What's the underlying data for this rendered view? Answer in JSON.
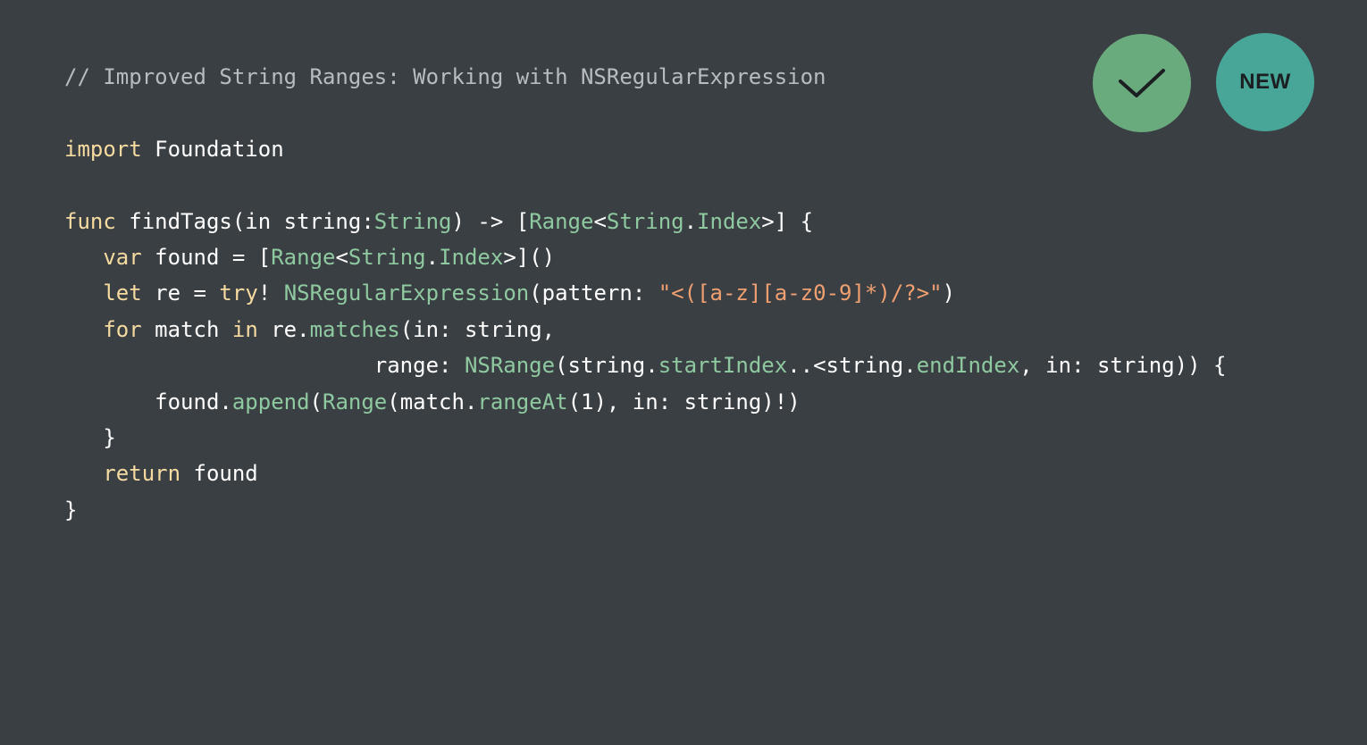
{
  "badges": {
    "check": {
      "icon": "checkmark-icon",
      "color": "#6aab7e"
    },
    "new": {
      "label": "NEW",
      "color": "#48a698"
    }
  },
  "code": {
    "lines": [
      [
        {
          "text": "// Improved String Ranges: Working with NSRegularExpression",
          "kind": "comment"
        }
      ],
      [],
      [
        {
          "text": "import",
          "kind": "keyword"
        },
        {
          "text": " Foundation",
          "kind": "plain"
        }
      ],
      [],
      [
        {
          "text": "func",
          "kind": "keyword"
        },
        {
          "text": " findTags(in string:",
          "kind": "plain"
        },
        {
          "text": "String",
          "kind": "type"
        },
        {
          "text": ") -> [",
          "kind": "plain"
        },
        {
          "text": "Range",
          "kind": "type"
        },
        {
          "text": "<",
          "kind": "plain"
        },
        {
          "text": "String",
          "kind": "type"
        },
        {
          "text": ".",
          "kind": "plain"
        },
        {
          "text": "Index",
          "kind": "type"
        },
        {
          "text": ">] {",
          "kind": "plain"
        }
      ],
      [
        {
          "text": "   ",
          "kind": "plain"
        },
        {
          "text": "var",
          "kind": "keyword"
        },
        {
          "text": " found = [",
          "kind": "plain"
        },
        {
          "text": "Range",
          "kind": "type"
        },
        {
          "text": "<",
          "kind": "plain"
        },
        {
          "text": "String",
          "kind": "type"
        },
        {
          "text": ".",
          "kind": "plain"
        },
        {
          "text": "Index",
          "kind": "type"
        },
        {
          "text": ">]()",
          "kind": "plain"
        }
      ],
      [
        {
          "text": "   ",
          "kind": "plain"
        },
        {
          "text": "let",
          "kind": "keyword"
        },
        {
          "text": " re = ",
          "kind": "plain"
        },
        {
          "text": "try",
          "kind": "keyword"
        },
        {
          "text": "! ",
          "kind": "plain"
        },
        {
          "text": "NSRegularExpression",
          "kind": "type"
        },
        {
          "text": "(pattern: ",
          "kind": "plain"
        },
        {
          "text": "\"<([a-z][a-z0-9]*)/?>\"",
          "kind": "string"
        },
        {
          "text": ")",
          "kind": "plain"
        }
      ],
      [
        {
          "text": "   ",
          "kind": "plain"
        },
        {
          "text": "for",
          "kind": "keyword"
        },
        {
          "text": " match ",
          "kind": "plain"
        },
        {
          "text": "in",
          "kind": "keyword"
        },
        {
          "text": " re.",
          "kind": "plain"
        },
        {
          "text": "matches",
          "kind": "method"
        },
        {
          "text": "(in: string,",
          "kind": "plain"
        }
      ],
      [
        {
          "text": "                        range: ",
          "kind": "plain"
        },
        {
          "text": "NSRange",
          "kind": "type"
        },
        {
          "text": "(string.",
          "kind": "plain"
        },
        {
          "text": "startIndex",
          "kind": "method"
        },
        {
          "text": "..<string.",
          "kind": "plain"
        },
        {
          "text": "endIndex",
          "kind": "method"
        },
        {
          "text": ", in: string)) {",
          "kind": "plain"
        }
      ],
      [
        {
          "text": "       found.",
          "kind": "plain"
        },
        {
          "text": "append",
          "kind": "method"
        },
        {
          "text": "(",
          "kind": "plain"
        },
        {
          "text": "Range",
          "kind": "type"
        },
        {
          "text": "(match.",
          "kind": "plain"
        },
        {
          "text": "rangeAt",
          "kind": "method"
        },
        {
          "text": "(1), in: string)!)",
          "kind": "plain"
        }
      ],
      [
        {
          "text": "   }",
          "kind": "plain"
        }
      ],
      [
        {
          "text": "   ",
          "kind": "plain"
        },
        {
          "text": "return",
          "kind": "keyword"
        },
        {
          "text": " found",
          "kind": "plain"
        }
      ],
      [
        {
          "text": "}",
          "kind": "plain"
        }
      ]
    ]
  }
}
